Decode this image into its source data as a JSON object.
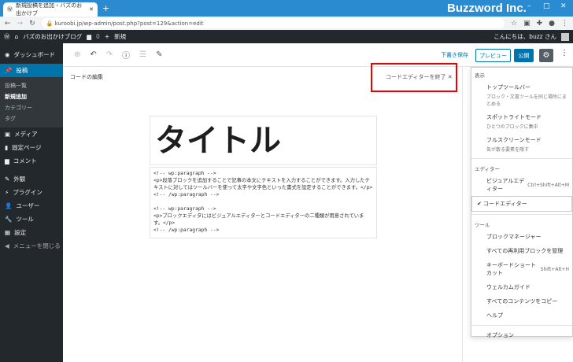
{
  "browser": {
    "tab_title": "新規投稿を追加 ‹ バズのお出かけブ",
    "new_tab": "+",
    "brand": "Buzzword Inc.",
    "url": "kuroobi.jp/wp-admin/post.php?post=129&action=edit"
  },
  "adminbar": {
    "site": "バズのお出かけブログ",
    "comments": "0",
    "new": "新規",
    "greeting": "こんにちは、buzz さん"
  },
  "sidebar": {
    "items": [
      {
        "label": "ダッシュボード"
      },
      {
        "label": "投稿"
      },
      {
        "label": "メディア"
      },
      {
        "label": "固定ページ"
      },
      {
        "label": "コメント"
      },
      {
        "label": "外観"
      },
      {
        "label": "プラグイン"
      },
      {
        "label": "ユーザー"
      },
      {
        "label": "ツール"
      },
      {
        "label": "設定"
      },
      {
        "label": "メニューを閉じる"
      }
    ],
    "sub": [
      "投稿一覧",
      "新規追加",
      "カテゴリー",
      "タグ"
    ]
  },
  "toolbar": {
    "save_draft": "下書き保存",
    "preview": "プレビュー",
    "publish": "公開"
  },
  "editor": {
    "header": "コードの編集",
    "exit": "コードエディターを終了",
    "title": "タイトル",
    "code": "<!-- wp:paragraph -->\n<p>段落ブロックを追加することで記事の本文にテキストを入力することができます。入力したテキストに対してはツールバーを使って太字や文字色といった書式を設定することができます。</p>\n<!-- /wp:paragraph -->\n\n<!-- wp:paragraph -->\n<p>ブロックエディタにはビジュアルエディターとコードエディターの二種類が用意されています。</p>\n<!-- /wp:paragraph -->"
  },
  "menu": {
    "view_heading": "表示",
    "top_toolbar": "トップツールバー",
    "top_toolbar_desc": "ブロック・文書ツールを同じ場所にまとめる",
    "spotlight": "スポットライトモード",
    "spotlight_desc": "ひとつのブロックに集中",
    "fullscreen": "フルスクリーンモード",
    "fullscreen_desc": "気が散る要素を隠す",
    "editor_heading": "エディター",
    "visual": "ビジュアルエディター",
    "visual_shortcut": "Ctrl+Shift+Alt+M",
    "code": "コードエディター",
    "tools_heading": "ツール",
    "block_manager": "ブロックマネージャー",
    "reusable": "すべての再利用ブロックを管理",
    "shortcuts": "キーボードショートカット",
    "shortcuts_key": "Shift+Alt+H",
    "welcome": "ウェルカムガイド",
    "copy_all": "すべてのコンテンツをコピー",
    "help": "ヘルプ",
    "options": "オプション"
  }
}
